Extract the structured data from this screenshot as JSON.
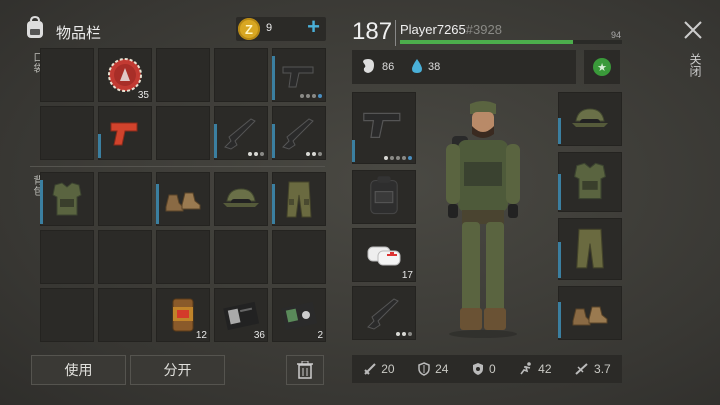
{
  "header": {
    "title": "物品栏",
    "coins": "9",
    "plus": "+"
  },
  "pockets_label": "口袋",
  "backpack_label": "背包",
  "player": {
    "level": "187",
    "name": "Player7265",
    "tag": "#3928",
    "xp_max": "94",
    "xp_fraction": 0.78,
    "hunger": "86",
    "thirst": "38"
  },
  "close_label": "关闭",
  "buttons": {
    "use": "使用",
    "split": "分开"
  },
  "cells": {
    "bottlecap": "35",
    "can": "12",
    "docs": "36",
    "id_card": "2",
    "bandage": "17"
  },
  "stats": {
    "attack": "20",
    "defense": "24",
    "radiation": "0",
    "speed": "42",
    "weight": "3.7"
  },
  "colors": {
    "accent_green": "#4cae4c",
    "durability_blue": "#3b7fa0"
  }
}
